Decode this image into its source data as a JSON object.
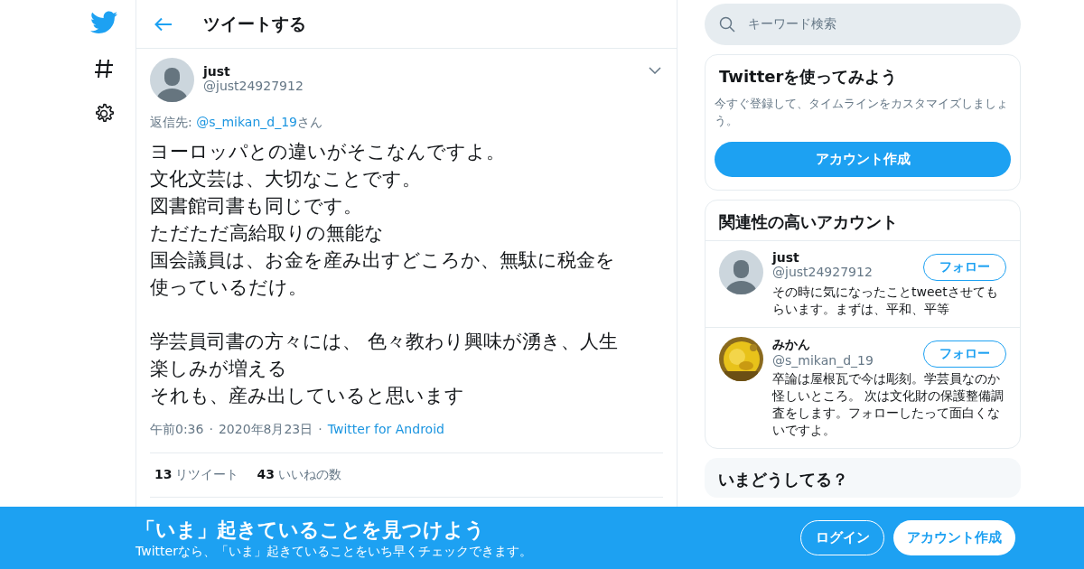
{
  "nav": {
    "items": [
      {
        "kind": "logo"
      },
      {
        "kind": "explore"
      },
      {
        "kind": "settings"
      }
    ]
  },
  "header": {
    "title": "ツイートする"
  },
  "tweet": {
    "name": "just",
    "handle": "@just24927912",
    "reply_label": "返信先: ",
    "reply_to": "@s_mikan_d_19",
    "reply_suffix": "さん",
    "paragraphs": [
      [
        "ヨーロッパとの違いがそこなんですよ。",
        "文化文芸は、大切なことです。",
        "図書館司書も同じです。",
        "ただただ高給取りの無能な",
        "国会議員は、お金を産み出すどころか、無駄に税金を",
        "使っているだけ。"
      ],
      [
        "学芸員司書の方々には、 色々教わり興味が湧き、人生",
        "楽しみが増える",
        "それも、産み出していると思います"
      ]
    ],
    "time": "午前0:36",
    "separator": "·",
    "date": "2020年8月23日",
    "source": "Twitter for Android",
    "stats": [
      {
        "count": "13",
        "label": "リツイート"
      },
      {
        "count": "43",
        "label": "いいねの数"
      }
    ]
  },
  "search": {
    "placeholder": "キーワード検索"
  },
  "signup_card": {
    "title": "Twitterを使ってみよう",
    "text": "今すぐ登録して、タイムラインをカスタマイズしましょう。",
    "button": "アカウント作成"
  },
  "related": {
    "title": "関連性の高いアカウント",
    "accounts": [
      {
        "name": "just",
        "handle": "@just24927912",
        "bio": "その時に気になったことtweetさせてもらいます。まずは、平和、平等",
        "button": "フォロー",
        "kind": "silhouette"
      },
      {
        "name": "みかん",
        "handle": "@s_mikan_d_19",
        "bio": "卒論は屋根瓦で今は彫刻。学芸員なのか怪しいところ。 次は文化財の保護整備調査をします。フォローしたって面白くないですよ。",
        "button": "フォロー",
        "kind": "picture"
      }
    ]
  },
  "trends": {
    "title": "いまどうしてる？"
  },
  "banner": {
    "title": "「いま」起きていることを見つけよう",
    "subtitle": "Twitterなら、「いま」起きていることをいち早くチェックできます。",
    "buttons": [
      {
        "label": "ログイン",
        "kind": "outline"
      },
      {
        "label": "アカウント作成",
        "kind": "solid"
      }
    ]
  }
}
